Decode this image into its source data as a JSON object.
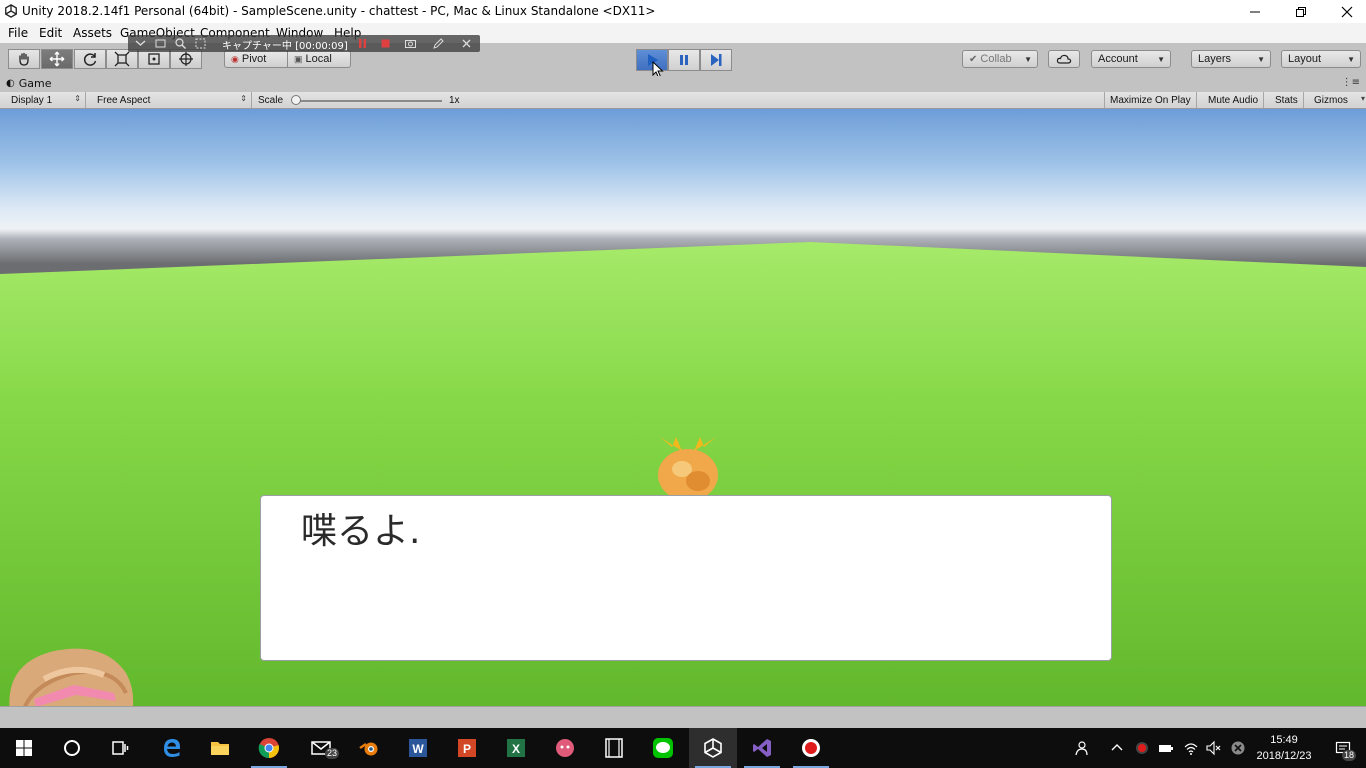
{
  "window": {
    "title": "Unity 2018.2.14f1 Personal (64bit) - SampleScene.unity - chattest - PC, Mac & Linux Standalone <DX11>"
  },
  "menu": {
    "items": [
      {
        "label": "File"
      },
      {
        "label": "Edit"
      },
      {
        "label": "Assets"
      },
      {
        "label": "GameObject"
      },
      {
        "label": "Component"
      },
      {
        "label": "Window"
      },
      {
        "label": "Help"
      }
    ]
  },
  "recorder": {
    "status": "キャプチャー中 [00:00:09]"
  },
  "toolbar": {
    "pivot_label": "Pivot",
    "local_label": "Local",
    "collab_label": "Collab",
    "account_label": "Account",
    "layers_label": "Layers",
    "layout_label": "Layout"
  },
  "game_panel": {
    "tab_label": "Game",
    "display_label": "Display 1",
    "aspect_label": "Free Aspect",
    "scale_label": "Scale",
    "scale_value": "1x",
    "maximize_label": "Maximize On Play",
    "mute_label": "Mute Audio",
    "stats_label": "Stats",
    "gizmos_label": "Gizmos"
  },
  "scene": {
    "dialog_text": "喋るよ."
  },
  "taskbar": {
    "mail_badge": "23",
    "notification_badge": "18",
    "clock_time": "15:49",
    "clock_date": "2018/12/23"
  },
  "colors": {
    "play_active": "#4a7fd0",
    "sky": "#9fc3e8",
    "grass": "#7fd640",
    "taskbar": "#0d0d0d"
  }
}
